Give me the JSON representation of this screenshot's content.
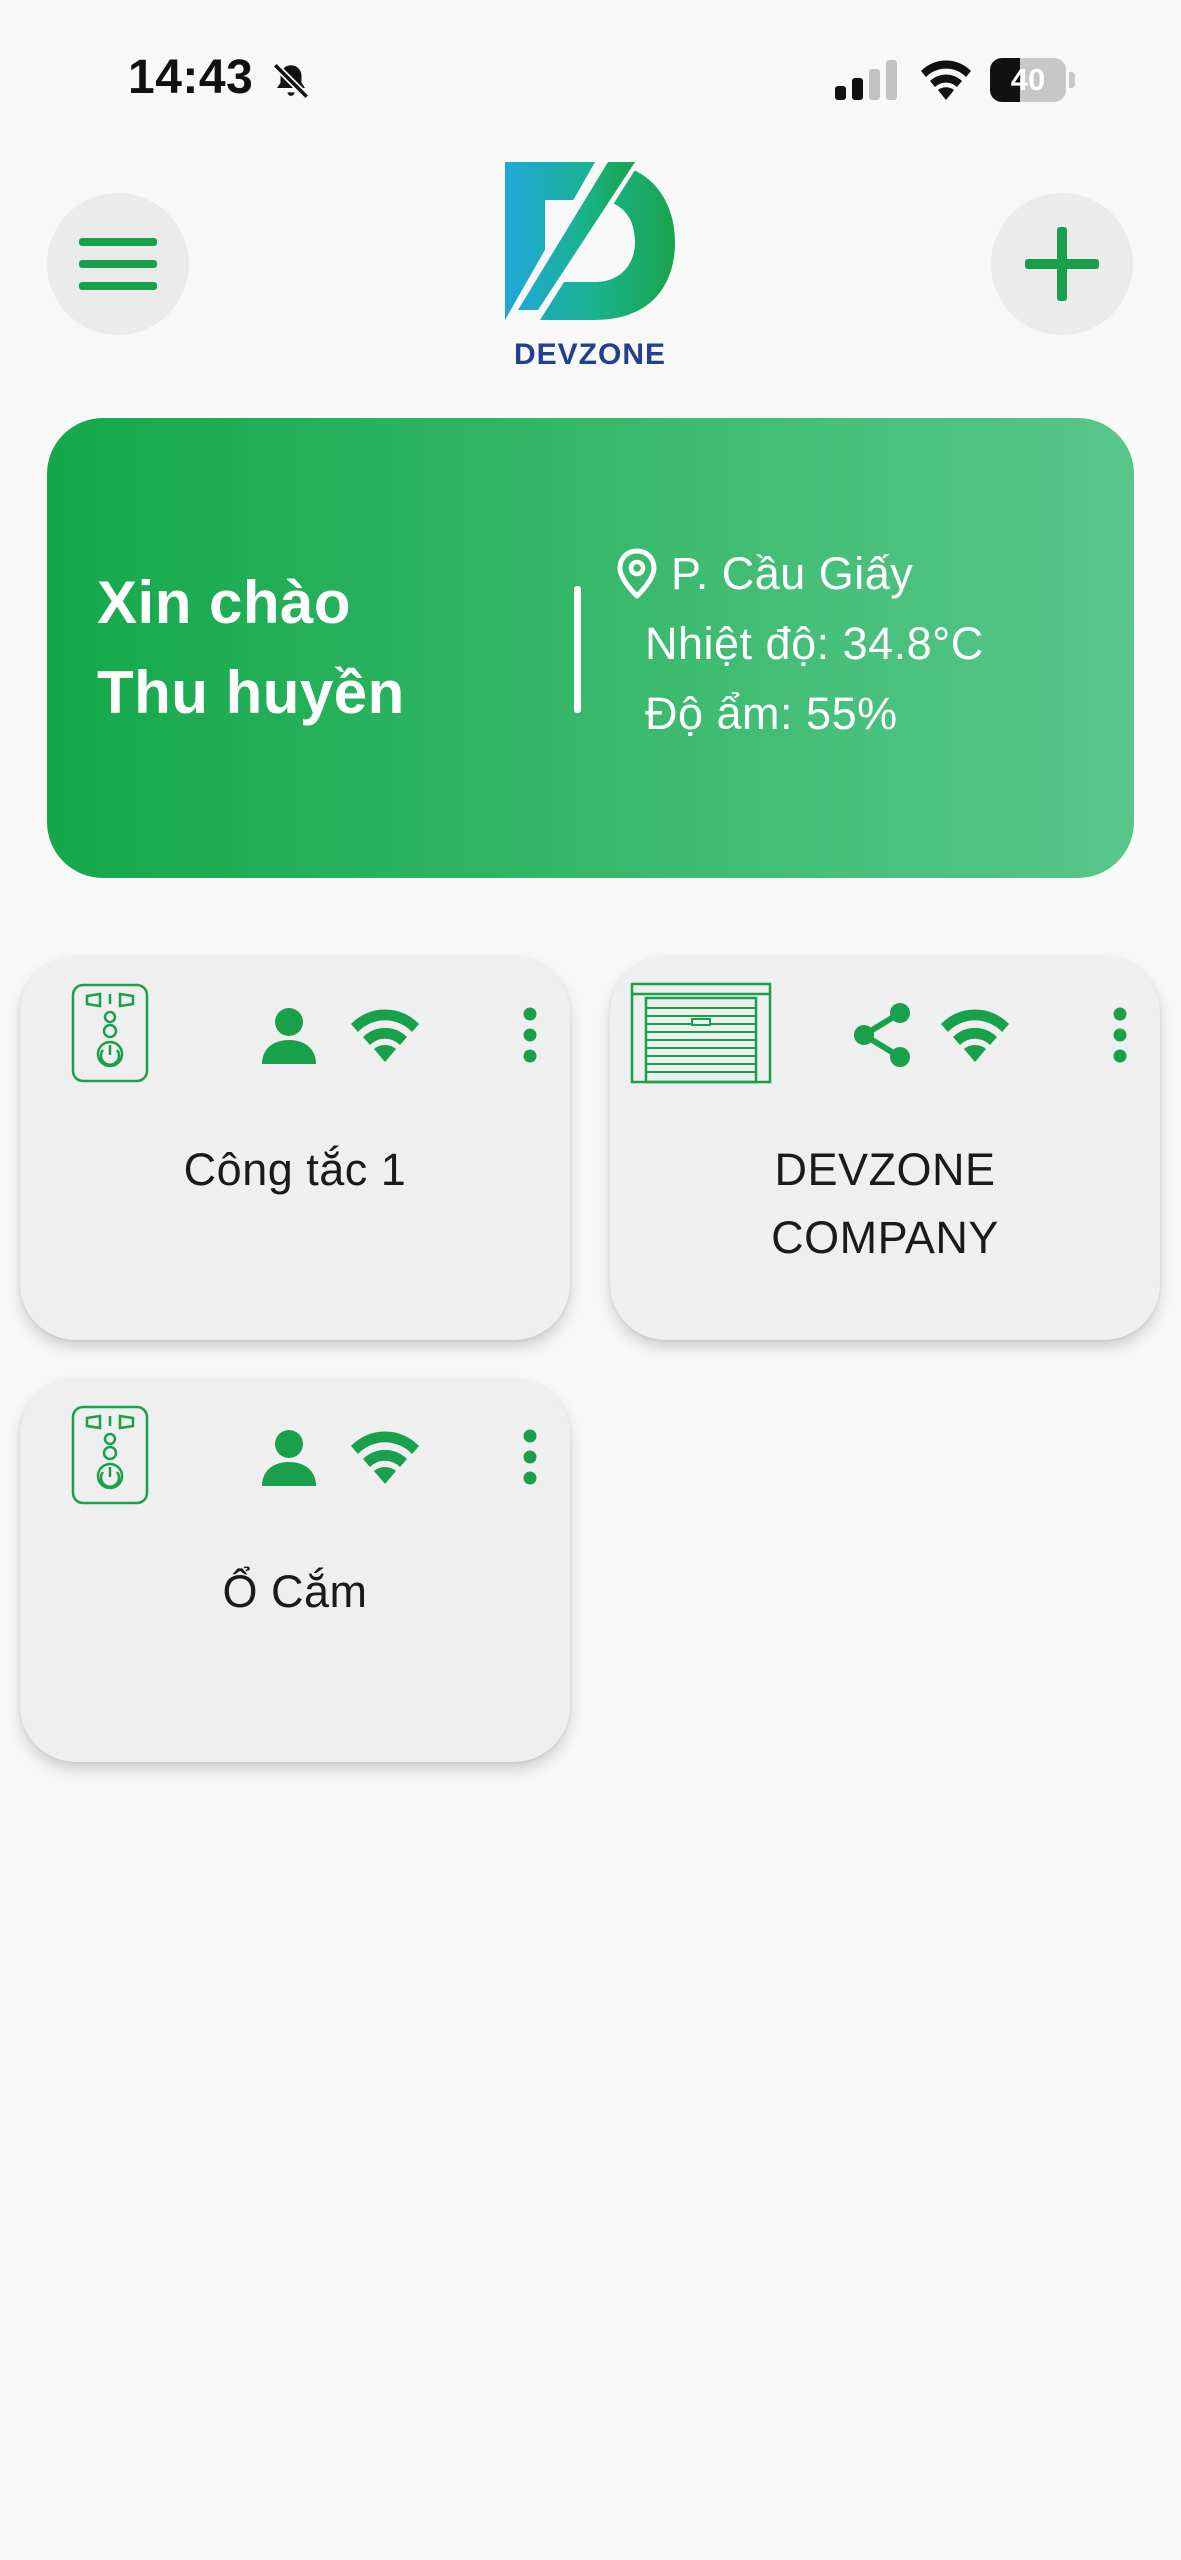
{
  "status_bar": {
    "time": "14:43",
    "battery": "40",
    "battery_level": 0.4,
    "icons": [
      "bell-off-icon",
      "signal-icon",
      "wifi-icon",
      "battery-icon"
    ]
  },
  "header": {
    "logo_text": "DEVZONE",
    "icons": [
      "menu-icon",
      "plus-icon"
    ]
  },
  "greeting": {
    "line1": "Xin chào",
    "line2": "Thu huyền",
    "location": "P. Cầu Giấy",
    "temperature": "Nhiệt độ: 34.8°C",
    "humidity": "Độ ẩm: 55%"
  },
  "devices": [
    {
      "name": "Công tắc 1",
      "icon": "smart-plug-icon",
      "owner_icon": "person-icon",
      "connection_icon": "wifi-icon"
    },
    {
      "name": "DEVZONE\nCOMPANY",
      "icon": "garage-door-icon",
      "owner_icon": "share-icon",
      "connection_icon": "wifi-icon"
    },
    {
      "name": "Ổ Cắm",
      "icon": "smart-plug-icon",
      "owner_icon": "person-icon",
      "connection_icon": "wifi-icon"
    }
  ],
  "colors": {
    "accent": "#19a04b",
    "card_gradient_start": "#14a84a",
    "card_gradient_end": "#58c68a",
    "logo_blue": "#23408e",
    "card_bg": "#efefef",
    "page_bg": "#f8f8f8"
  }
}
